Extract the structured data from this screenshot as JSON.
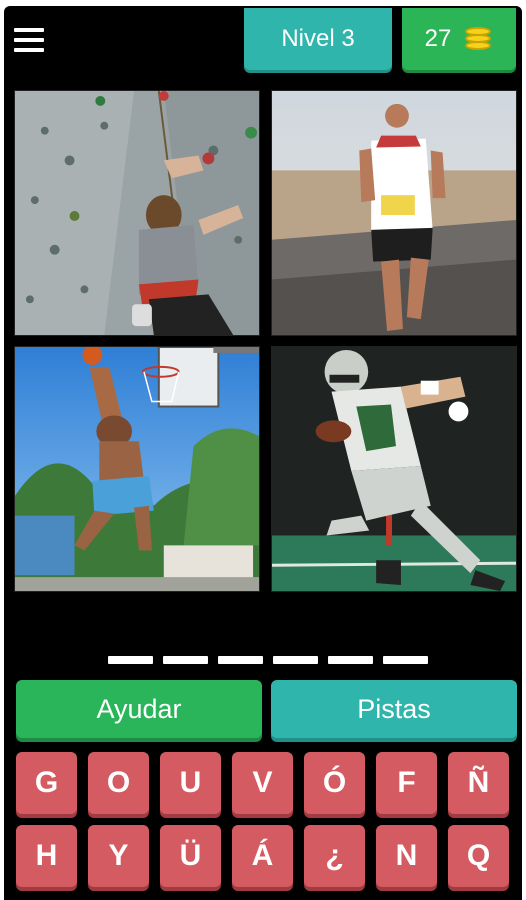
{
  "header": {
    "level_label": "Nivel 3",
    "coins": "27",
    "coin_icon": "coin-stack-icon",
    "menu_icon": "hamburger-menu-icon"
  },
  "answer": {
    "letter_count": 6
  },
  "buttons": {
    "help": "Ayudar",
    "hints": "Pistas"
  },
  "keyboard": {
    "rows": [
      [
        "G",
        "O",
        "U",
        "V",
        "Ó",
        "F",
        "Ñ"
      ],
      [
        "H",
        "Y",
        "Ü",
        "Á",
        "¿",
        "N",
        "Q"
      ]
    ]
  },
  "colors": {
    "background": "#000000",
    "level_pill": "#2fb5ab",
    "coins_pill": "#2bb556",
    "help_button": "#2ab55a",
    "hints_button": "#2fb5ab",
    "key": "#d55b62"
  }
}
